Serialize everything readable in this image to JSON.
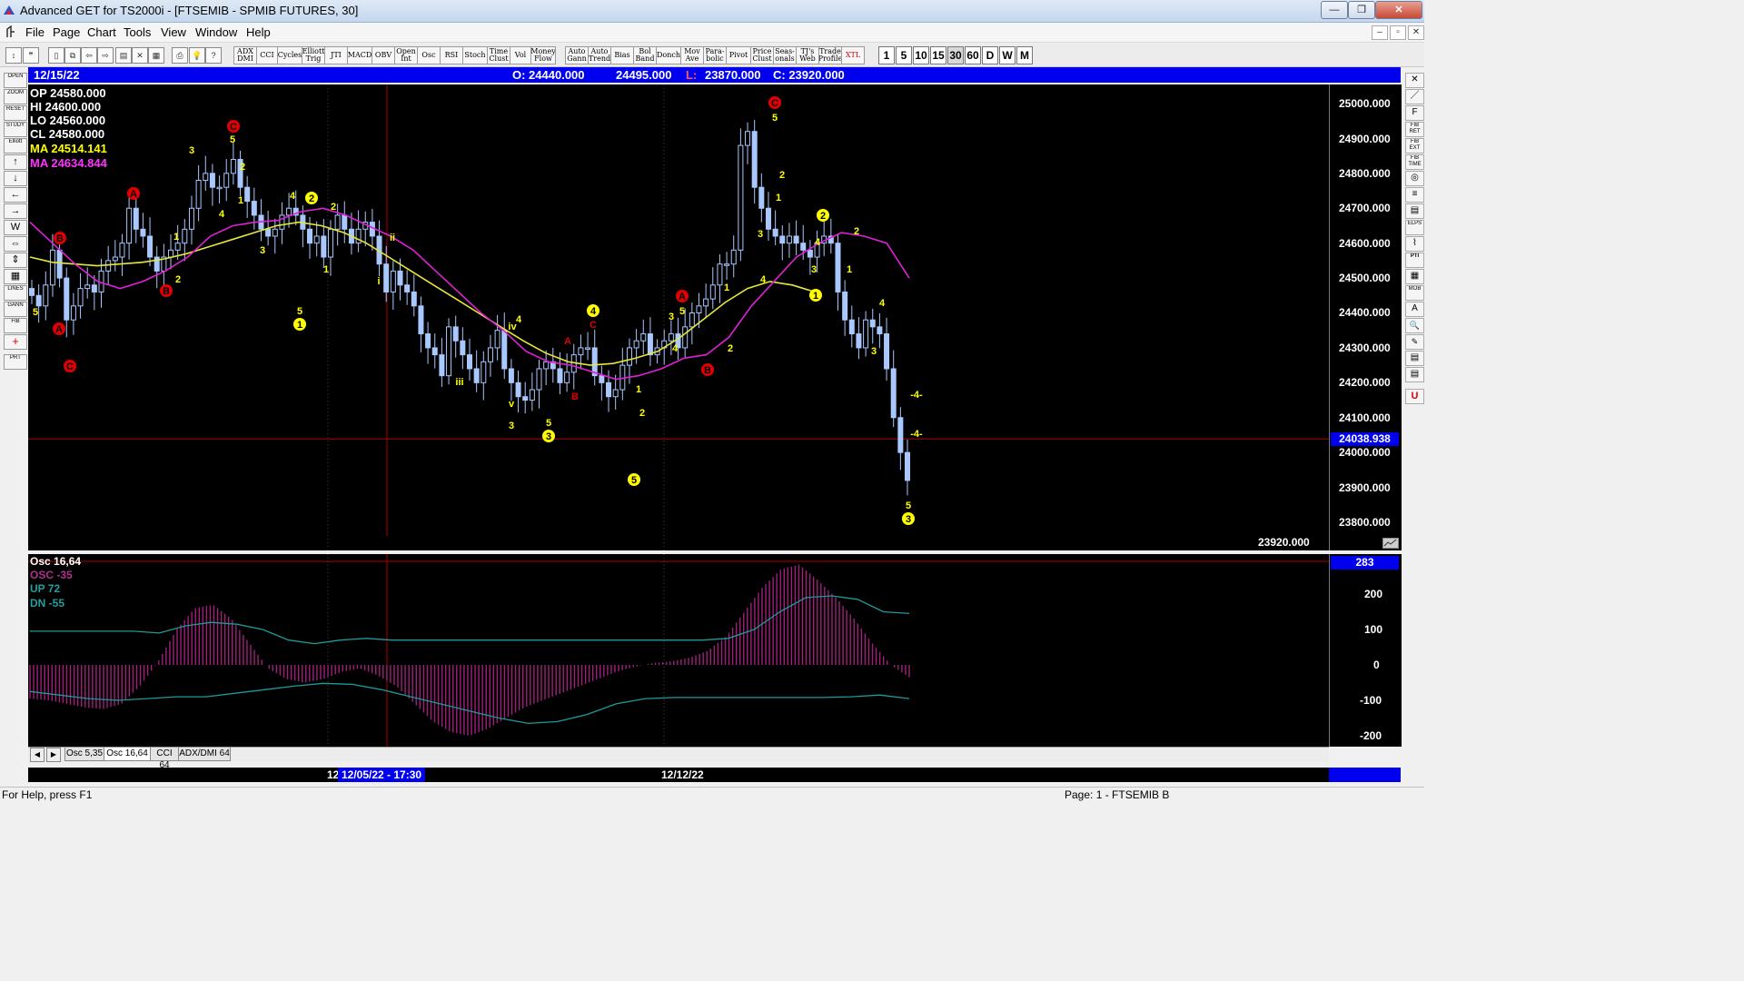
{
  "window": {
    "title": "Advanced GET for TS2000i - [FTSEMIB - SPMIB FUTURES, 30]",
    "min": "—",
    "max": "❐",
    "close": "✕"
  },
  "mdi": {
    "min": "–",
    "restore": "▫",
    "close": "✕"
  },
  "menu": [
    "File",
    "Page",
    "Chart",
    "Tools",
    "View",
    "Window",
    "Help"
  ],
  "toolbar": {
    "studies": [
      "ADX DMI",
      "CCI",
      "Cycles",
      "Elliott Trig",
      "JTI",
      "MACD",
      "OBV",
      "Open Int",
      "Osc",
      "RSI",
      "Stoch",
      "Time Clust",
      "Vol",
      "Money Flow",
      "Auto Gann",
      "Auto Trend",
      "Bias",
      "Bol Band",
      "Donch",
      "Mov Ave",
      "Para- bolic",
      "Pivot",
      "Price Clust",
      "Seas- onals",
      "TJ's Web",
      "Trade Profile",
      "XTL"
    ],
    "timeframes": [
      "1",
      "5",
      "10",
      "15",
      "30",
      "60",
      "D",
      "W",
      "M"
    ],
    "active_timeframe": "30"
  },
  "left_tools": [
    "OPEN",
    "ZOOM",
    "RESET",
    "STUDY",
    "Elliott",
    "↑",
    "↓",
    "←",
    "→",
    "W",
    "⇔",
    "⇕",
    "▦",
    "LINES",
    "GANN",
    "FIB",
    "+",
    "PRT"
  ],
  "right_tools": [
    "✕",
    "／",
    "F",
    "FIB RET",
    "FIB EXT",
    "FIB TIME",
    "◎",
    "≡",
    "▤",
    "ELPS",
    "⌇",
    "PTI",
    "▦",
    "MOB",
    "A",
    "🔍",
    "✎",
    "▤",
    "▤",
    "U"
  ],
  "header": {
    "date": "12/15/22",
    "open": "O: 24440.000",
    "high": "24495.000",
    "low_label": "L:",
    "low": "23870.000",
    "close": "C: 23920.000"
  },
  "overlay": {
    "op": "OP  24580.000",
    "hi": "HI   24600.000",
    "lo": "LO  24560.000",
    "cl": "CL  24580.000",
    "ma1": "MA  24514.141",
    "ma2": "MA  24634.844"
  },
  "price_axis": {
    "ticks": [
      "25000.000",
      "24900.000",
      "24800.000",
      "24700.000",
      "24600.000",
      "24500.000",
      "24400.000",
      "24300.000",
      "24200.000",
      "24100.000",
      "24000.000",
      "23900.000",
      "23800.000"
    ],
    "cursor_value": "24038.938",
    "last_price": "23920.000"
  },
  "osc_panel": {
    "title": "Osc 16,64",
    "osc": "OSC -35",
    "up": "UP    72",
    "dn": "DN    -55",
    "axis_value": "283",
    "ticks": [
      "200",
      "100",
      "0",
      "-100",
      "-200"
    ]
  },
  "tabs": [
    "Osc 5,35",
    "Osc 16,64",
    "CCI 64",
    "ADX/DMI 64"
  ],
  "active_tab": "Osc 16,64",
  "time_axis": {
    "cut": "12",
    "cursor": "12/05/22 - 17:30",
    "mid": "12/12/22"
  },
  "status": {
    "help": "For Help, press F1",
    "page": "Page: 1 - FTSEMIB B"
  },
  "chart_data": {
    "type": "candlestick",
    "symbol": "FTSEMIB - SPMIB FUTURES",
    "interval": "30",
    "ylim": [
      23750,
      25050
    ],
    "closes": [
      24450,
      24420,
      24480,
      24580,
      24500,
      24380,
      24420,
      24470,
      24480,
      24460,
      24520,
      24550,
      24560,
      24600,
      24700,
      24640,
      24620,
      24560,
      24520,
      24560,
      24580,
      24600,
      24640,
      24700,
      24780,
      24800,
      24760,
      24760,
      24800,
      24840,
      24760,
      24720,
      24680,
      24640,
      24620,
      24640,
      24680,
      24700,
      24680,
      24640,
      24600,
      24620,
      24560,
      24640,
      24680,
      24640,
      24600,
      24640,
      24660,
      24620,
      24540,
      24460,
      24520,
      24480,
      24460,
      24420,
      24340,
      24300,
      24280,
      24220,
      24360,
      24320,
      24280,
      24240,
      24200,
      24260,
      24300,
      24350,
      24240,
      24200,
      24160,
      24150,
      24180,
      24240,
      24260,
      24240,
      24200,
      24230,
      24280,
      24300,
      24300,
      24220,
      24200,
      24160,
      24180,
      24250,
      24300,
      24320,
      24340,
      24280,
      24300,
      24320,
      24340,
      24300,
      24360,
      24400,
      24420,
      24440,
      24480,
      24540,
      24540,
      24580,
      24880,
      24920,
      24760,
      24700,
      24640,
      24620,
      24600,
      24620,
      24600,
      24580,
      24560,
      24600,
      24620,
      24600,
      24460,
      24380,
      24340,
      24300,
      24380,
      24360,
      24340,
      24240,
      24100,
      24000,
      23920
    ],
    "ma_fast": [
      24560,
      24545,
      24540,
      24535,
      24540,
      24545,
      24555,
      24570,
      24590,
      24610,
      24630,
      24650,
      24660,
      24650,
      24630,
      24600,
      24560,
      24520,
      24480,
      24440,
      24400,
      24360,
      24320,
      24285,
      24260,
      24250,
      24255,
      24270,
      24290,
      24330,
      24380,
      24430,
      24470,
      24490,
      24480,
      24460
    ],
    "ma_slow": [
      24660,
      24600,
      24540,
      24490,
      24470,
      24490,
      24520,
      24560,
      24620,
      24650,
      24660,
      24665,
      24690,
      24700,
      24680,
      24650,
      24620,
      24580,
      24520,
      24460,
      24400,
      24350,
      24290,
      24260,
      24250,
      24230,
      24210,
      24220,
      24240,
      24270,
      24280,
      24330,
      24420,
      24490,
      24560,
      24600,
      24630,
      24620,
      24600,
      24500
    ],
    "osc_values": [
      -95,
      -100,
      -110,
      -120,
      -125,
      -110,
      -60,
      10,
      100,
      160,
      170,
      130,
      60,
      -10,
      -40,
      -50,
      -40,
      -20,
      -10,
      -30,
      -60,
      -110,
      -160,
      -190,
      -200,
      -180,
      -150,
      -120,
      -100,
      -80,
      -60,
      -40,
      -20,
      -5,
      5,
      10,
      20,
      40,
      80,
      150,
      220,
      270,
      283,
      240,
      190,
      130,
      60,
      0,
      -35
    ],
    "up_line": [
      95,
      95,
      95,
      95,
      95,
      90,
      110,
      120,
      115,
      100,
      70,
      60,
      70,
      75,
      70,
      70,
      70,
      70,
      70,
      70,
      70,
      70,
      70,
      70,
      70,
      70,
      70,
      75,
      100,
      150,
      190,
      195,
      185,
      150,
      145
    ],
    "dn_line": [
      -75,
      -85,
      -95,
      -100,
      -95,
      -90,
      -90,
      -80,
      -70,
      -60,
      -52,
      -55,
      -70,
      -90,
      -110,
      -130,
      -150,
      -165,
      -160,
      -140,
      -110,
      -95,
      -92,
      -92,
      -92,
      -92,
      -92,
      -92,
      -90,
      -85,
      -95
    ]
  }
}
